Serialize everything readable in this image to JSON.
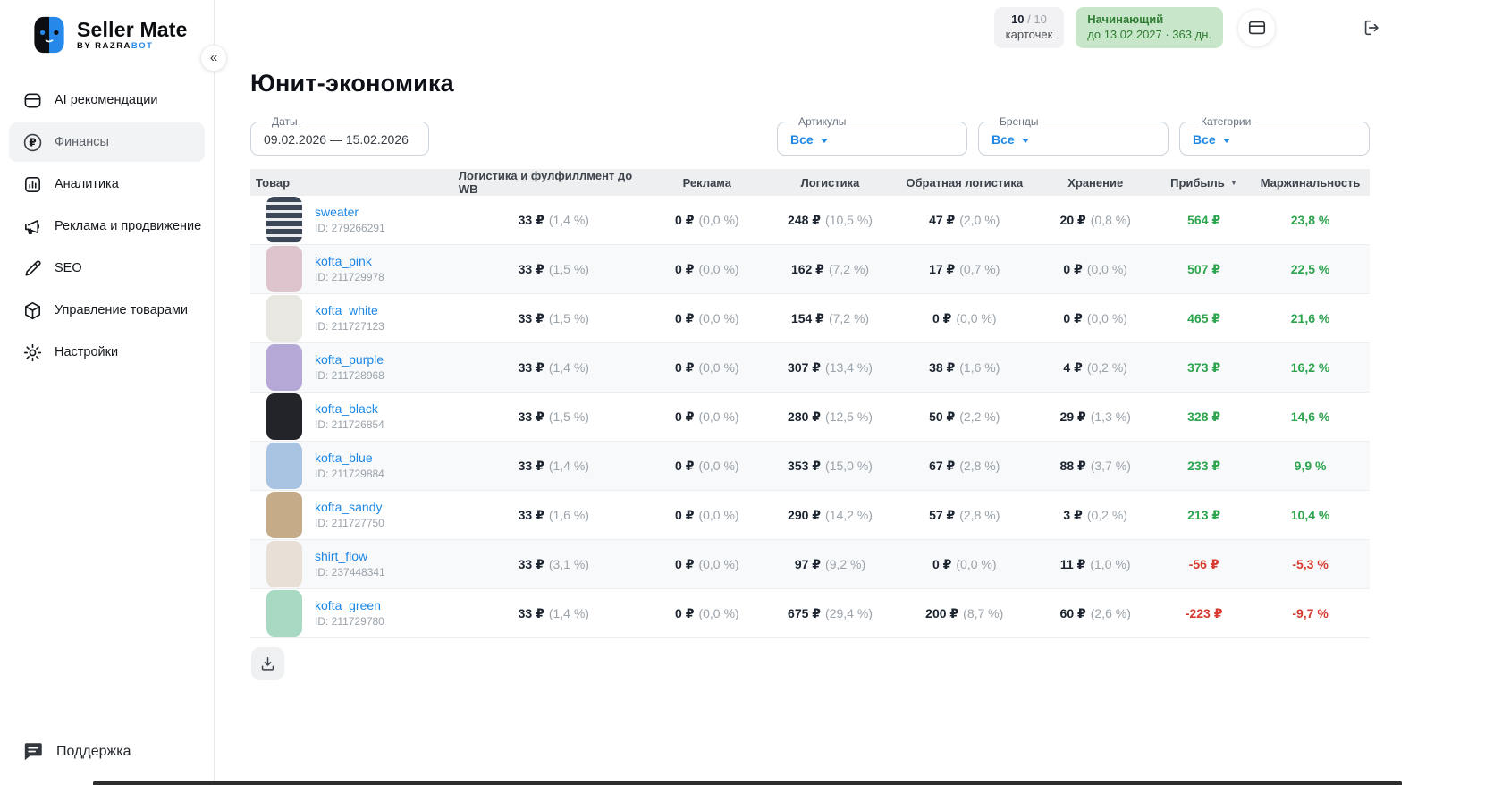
{
  "brand": {
    "name": "Seller Mate",
    "by_prefix": "BY RAZRA",
    "by_suffix": "BOT"
  },
  "sidebar": {
    "collapse_glyph": "«",
    "items": [
      {
        "label": "AI рекомендации",
        "icon": "ai-recommendations-icon",
        "active": false
      },
      {
        "label": "Финансы",
        "icon": "finance-ruble-icon",
        "active": true
      },
      {
        "label": "Аналитика",
        "icon": "analytics-chart-icon",
        "active": false
      },
      {
        "label": "Реклама и продвижение",
        "icon": "megaphone-icon",
        "active": false
      },
      {
        "label": "SEO",
        "icon": "pencil-icon",
        "active": false
      },
      {
        "label": "Управление товарами",
        "icon": "cube-icon",
        "active": false
      },
      {
        "label": "Настройки",
        "icon": "gear-icon",
        "active": false
      }
    ],
    "support_label": "Поддержка"
  },
  "topbar": {
    "cards_badge": {
      "current": "10",
      "total": " / 10",
      "label": "карточек"
    },
    "plan_badge": {
      "name": "Начинающий",
      "expires": "до 13.02.2027 · 363 дн."
    }
  },
  "page": {
    "title": "Юнит-экономика",
    "filters": {
      "dates": {
        "label": "Даты",
        "value": "09.02.2026 — 15.02.2026"
      },
      "articles": {
        "label": "Артикулы",
        "value": "Все"
      },
      "brands": {
        "label": "Бренды",
        "value": "Все"
      },
      "categories": {
        "label": "Категории",
        "value": "Все"
      }
    }
  },
  "table": {
    "columns": [
      "Товар",
      "Логистика и фулфиллмент до WB",
      "Реклама",
      "Логистика",
      "Обратная логистика",
      "Хранение",
      "Прибыль",
      "Маржинальность"
    ],
    "sorted_by": "Прибыль",
    "sort_direction": "desc",
    "rows": [
      {
        "name": "sweater",
        "id": "ID: 279266291",
        "thumb_color": "#3b4757",
        "thumb_stripes": true,
        "metrics": [
          {
            "v": "33 ₽",
            "p": "(1,4 %)"
          },
          {
            "v": "0 ₽",
            "p": "(0,0 %)"
          },
          {
            "v": "248 ₽",
            "p": "(10,5 %)"
          },
          {
            "v": "47 ₽",
            "p": "(2,0 %)"
          },
          {
            "v": "20 ₽",
            "p": "(0,8 %)"
          }
        ],
        "profit": "564 ₽",
        "margin": "23,8 %",
        "negative": false
      },
      {
        "name": "kofta_pink",
        "id": "ID: 211729978",
        "thumb_color": "#ddc3cb",
        "thumb_stripes": false,
        "metrics": [
          {
            "v": "33 ₽",
            "p": "(1,5 %)"
          },
          {
            "v": "0 ₽",
            "p": "(0,0 %)"
          },
          {
            "v": "162 ₽",
            "p": "(7,2 %)"
          },
          {
            "v": "17 ₽",
            "p": "(0,7 %)"
          },
          {
            "v": "0 ₽",
            "p": "(0,0 %)"
          }
        ],
        "profit": "507 ₽",
        "margin": "22,5 %",
        "negative": false
      },
      {
        "name": "kofta_white",
        "id": "ID: 211727123",
        "thumb_color": "#e9e7e2",
        "thumb_stripes": false,
        "metrics": [
          {
            "v": "33 ₽",
            "p": "(1,5 %)"
          },
          {
            "v": "0 ₽",
            "p": "(0,0 %)"
          },
          {
            "v": "154 ₽",
            "p": "(7,2 %)"
          },
          {
            "v": "0 ₽",
            "p": "(0,0 %)"
          },
          {
            "v": "0 ₽",
            "p": "(0,0 %)"
          }
        ],
        "profit": "465 ₽",
        "margin": "21,6 %",
        "negative": false
      },
      {
        "name": "kofta_purple",
        "id": "ID: 211728968",
        "thumb_color": "#b5a8d6",
        "thumb_stripes": false,
        "metrics": [
          {
            "v": "33 ₽",
            "p": "(1,4 %)"
          },
          {
            "v": "0 ₽",
            "p": "(0,0 %)"
          },
          {
            "v": "307 ₽",
            "p": "(13,4 %)"
          },
          {
            "v": "38 ₽",
            "p": "(1,6 %)"
          },
          {
            "v": "4 ₽",
            "p": "(0,2 %)"
          }
        ],
        "profit": "373 ₽",
        "margin": "16,2 %",
        "negative": false
      },
      {
        "name": "kofta_black",
        "id": "ID: 211726854",
        "thumb_color": "#23232a",
        "thumb_stripes": false,
        "metrics": [
          {
            "v": "33 ₽",
            "p": "(1,5 %)"
          },
          {
            "v": "0 ₽",
            "p": "(0,0 %)"
          },
          {
            "v": "280 ₽",
            "p": "(12,5 %)"
          },
          {
            "v": "50 ₽",
            "p": "(2,2 %)"
          },
          {
            "v": "29 ₽",
            "p": "(1,3 %)"
          }
        ],
        "profit": "328 ₽",
        "margin": "14,6 %",
        "negative": false
      },
      {
        "name": "kofta_blue",
        "id": "ID: 211729884",
        "thumb_color": "#a9c3e2",
        "thumb_stripes": false,
        "metrics": [
          {
            "v": "33 ₽",
            "p": "(1,4 %)"
          },
          {
            "v": "0 ₽",
            "p": "(0,0 %)"
          },
          {
            "v": "353 ₽",
            "p": "(15,0 %)"
          },
          {
            "v": "67 ₽",
            "p": "(2,8 %)"
          },
          {
            "v": "88 ₽",
            "p": "(3,7 %)"
          }
        ],
        "profit": "233 ₽",
        "margin": "9,9 %",
        "negative": false
      },
      {
        "name": "kofta_sandy",
        "id": "ID: 211727750",
        "thumb_color": "#c6ab89",
        "thumb_stripes": false,
        "metrics": [
          {
            "v": "33 ₽",
            "p": "(1,6 %)"
          },
          {
            "v": "0 ₽",
            "p": "(0,0 %)"
          },
          {
            "v": "290 ₽",
            "p": "(14,2 %)"
          },
          {
            "v": "57 ₽",
            "p": "(2,8 %)"
          },
          {
            "v": "3 ₽",
            "p": "(0,2 %)"
          }
        ],
        "profit": "213 ₽",
        "margin": "10,4 %",
        "negative": false
      },
      {
        "name": "shirt_flow",
        "id": "ID: 237448341",
        "thumb_color": "#e8dfd7",
        "thumb_stripes": false,
        "metrics": [
          {
            "v": "33 ₽",
            "p": "(3,1 %)"
          },
          {
            "v": "0 ₽",
            "p": "(0,0 %)"
          },
          {
            "v": "97 ₽",
            "p": "(9,2 %)"
          },
          {
            "v": "0 ₽",
            "p": "(0,0 %)"
          },
          {
            "v": "11 ₽",
            "p": "(1,0 %)"
          }
        ],
        "profit": "-56 ₽",
        "margin": "-5,3 %",
        "negative": true
      },
      {
        "name": "kofta_green",
        "id": "ID: 211729780",
        "thumb_color": "#a7d9c3",
        "thumb_stripes": false,
        "metrics": [
          {
            "v": "33 ₽",
            "p": "(1,4 %)"
          },
          {
            "v": "0 ₽",
            "p": "(0,0 %)"
          },
          {
            "v": "675 ₽",
            "p": "(29,4 %)"
          },
          {
            "v": "200 ₽",
            "p": "(8,7 %)"
          },
          {
            "v": "60 ₽",
            "p": "(2,6 %)"
          }
        ],
        "profit": "-223 ₽",
        "margin": "-9,7 %",
        "negative": true
      }
    ]
  },
  "colors": {
    "accent_blue": "#1e88e5",
    "positive_green": "#2da44e",
    "negative_red": "#d63a30",
    "plan_badge_bg": "#c8e6c9",
    "plan_badge_text": "#2e7d32"
  }
}
